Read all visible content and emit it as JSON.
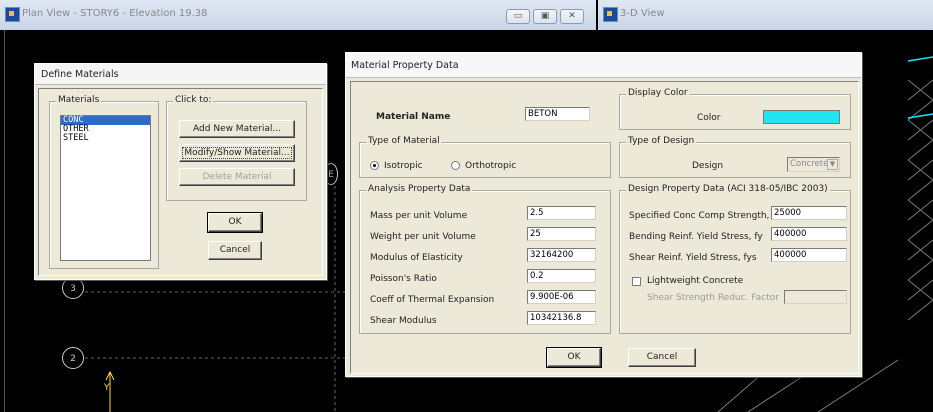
{
  "plan_window": {
    "title": "Plan View - STORY6 - Elevation 19.38",
    "controls": {
      "minimize": "▭",
      "restore": "▣",
      "close": "✕"
    },
    "grid_bubbles": [
      "3",
      "2",
      "E"
    ],
    "axis_label": "Y"
  },
  "view3d_window": {
    "title": "3-D View"
  },
  "define_materials": {
    "title": "Define Materials",
    "materials_label": "Materials",
    "materials": [
      "CONC",
      "OTHER",
      "STEEL"
    ],
    "selected": "CONC",
    "click_to_label": "Click to:",
    "add_button": "Add New Material...",
    "modify_button": "Modify/Show Material...",
    "delete_button": "Delete Material",
    "ok_button": "OK",
    "cancel_button": "Cancel"
  },
  "material_property": {
    "title": "Material Property Data",
    "material_name_label": "Material Name",
    "material_name_value": "BETON",
    "display_color_label": "Display Color",
    "color_label": "Color",
    "color_value": "#22e5f2",
    "type_of_material_label": "Type of Material",
    "isotropic_label": "Isotropic",
    "orthotropic_label": "Orthotropic",
    "type_of_design_label": "Type of Design",
    "design_label": "Design",
    "design_value": "Concrete",
    "analysis_label": "Analysis Property Data",
    "analysis": [
      {
        "label": "Mass per unit Volume",
        "value": "2.5"
      },
      {
        "label": "Weight per unit Volume",
        "value": "25"
      },
      {
        "label": "Modulus of Elasticity",
        "value": "32164200"
      },
      {
        "label": "Poisson's Ratio",
        "value": "0.2"
      },
      {
        "label": "Coeff of Thermal Expansion",
        "value": "9.900E-06"
      },
      {
        "label": "Shear Modulus",
        "value": "10342136.8"
      }
    ],
    "design_property_label": "Design Property Data (ACI 318-05/IBC 2003)",
    "design_props": [
      {
        "label": "Specified Conc Comp Strength, f'c",
        "value": "25000"
      },
      {
        "label": "Bending Reinf. Yield Stress, fy",
        "value": "400000"
      },
      {
        "label": "Shear Reinf. Yield Stress, fys",
        "value": "400000"
      }
    ],
    "lightweight_label": "Lightweight Concrete",
    "shear_reduc_label": "Shear Strength Reduc. Factor",
    "ok_button": "OK",
    "cancel_button": "Cancel"
  }
}
